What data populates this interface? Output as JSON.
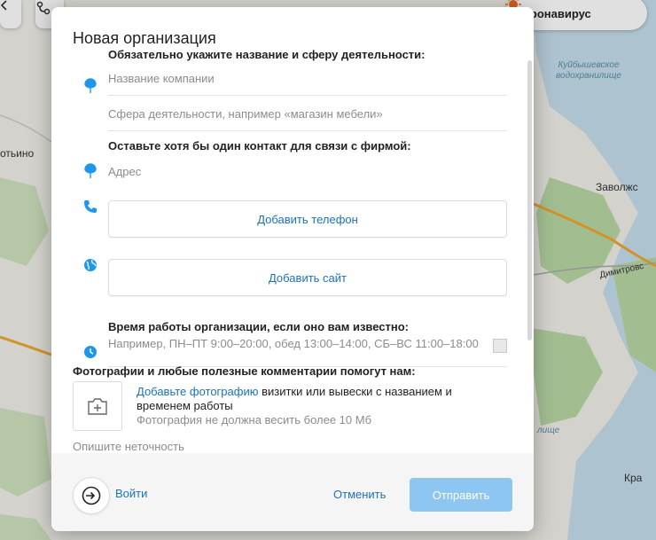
{
  "map": {
    "labels": {
      "left_town": "отьино",
      "right_town": "Заволжс",
      "road": "Димитровс",
      "bottom_right": "Кра",
      "water_top": "Куйбышевское водохранилище",
      "water_bottom": "лище"
    },
    "corona_button": {
      "label": "Коронавирус",
      "icon": "virus-icon"
    },
    "colors": {
      "land": "#f2efe9",
      "forest": "#b9d9a6",
      "water": "#c5dfec",
      "road": "#f0a830"
    }
  },
  "modal": {
    "title": "Новая организация",
    "section_required": "Обязательно укажите название и сферу деятельности:",
    "name_placeholder": "Название компании",
    "activity_placeholder": "Сфера деятельности, например «магазин мебели»",
    "section_contact": "Оставьте хотя бы один контакт для связи с фирмой:",
    "address_placeholder": "Адрес",
    "add_phone": "Добавить телефон",
    "add_site": "Добавить сайт",
    "section_hours": "Время работы организации, если оно вам известно:",
    "hours_placeholder": "Например, ПН–ПТ 9:00–20:00, обед 13:00–14:00, СБ–ВС 11:00–18:00",
    "section_photos": "Фотографии и любые полезные комментарии помогут нам:",
    "photo_link": "Добавьте фотографию",
    "photo_text": " визитки или вывески с названием и временем работы",
    "photo_note": "Фотография не должна весить более 10 Мб",
    "describe_placeholder": "Опишите неточность",
    "accent_color": "#1a73b8",
    "icon_color": "#1e96f0"
  },
  "footer": {
    "login": "Войти",
    "cancel": "Отменить",
    "submit": "Отправить",
    "submit_color": "#8ec6f2"
  }
}
